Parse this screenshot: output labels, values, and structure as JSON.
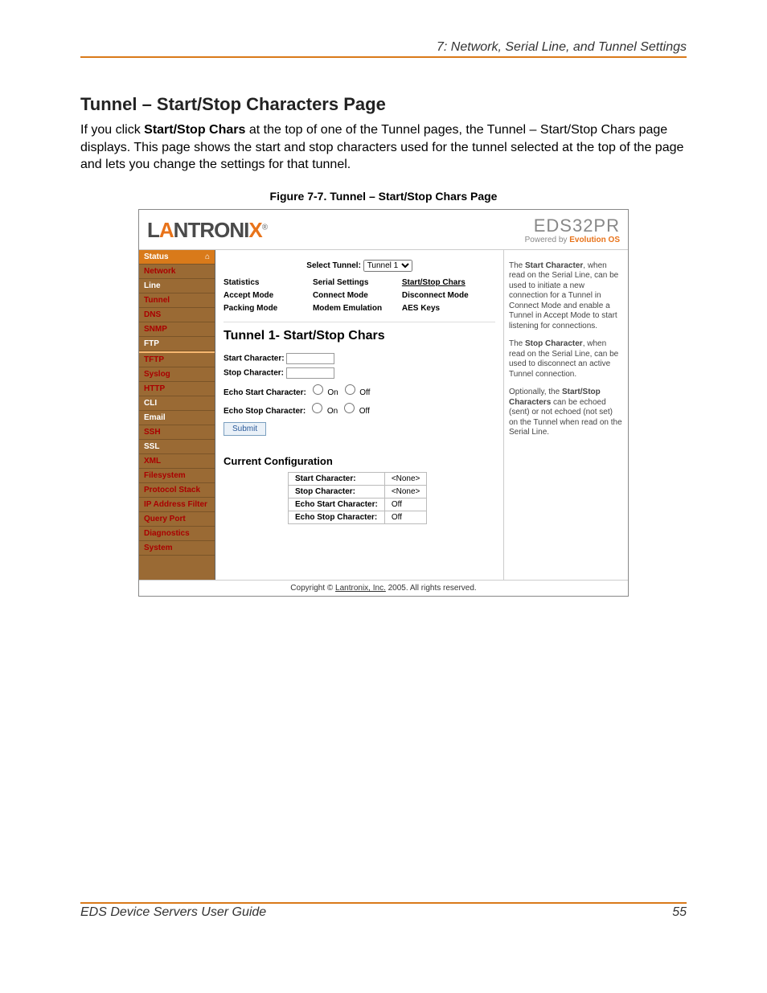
{
  "header_section": "7: Network, Serial Line, and Tunnel Settings",
  "heading": "Tunnel – Start/Stop Characters Page",
  "intro_p1": "If you click ",
  "intro_bold": "Start/Stop Chars",
  "intro_p2": " at the top of one of the Tunnel pages, the Tunnel – Start/Stop Chars page displays. This page shows the start and stop characters used for the tunnel selected at the top of the page and lets you change the settings for that tunnel.",
  "figure_caption": "Figure 7-7. Tunnel – Start/Stop Chars Page",
  "logo_left_a": "L",
  "logo_left_b": "A",
  "logo_left_c": "NTRONI",
  "logo_left_d": "X",
  "logo_left_reg": "®",
  "logo_right_model": "EDS32PR",
  "logo_right_powered": "Powered by ",
  "logo_right_evo": "Evolution OS",
  "sidebar": {
    "items": [
      "Status",
      "Network",
      "Line",
      "Tunnel",
      "DNS",
      "SNMP",
      "FTP",
      "TFTP",
      "Syslog",
      "HTTP",
      "CLI",
      "Email",
      "SSH",
      "SSL",
      "XML",
      "Filesystem",
      "Protocol Stack",
      "IP Address Filter",
      "Query Port",
      "Diagnostics",
      "System"
    ]
  },
  "select_tunnel_label": "Select Tunnel:",
  "select_tunnel_value": "Tunnel 1",
  "subnav": {
    "row1": [
      "Statistics",
      "Serial Settings",
      "Start/Stop Chars"
    ],
    "row2": [
      "Accept Mode",
      "Connect Mode",
      "Disconnect Mode"
    ],
    "row3": [
      "Packing Mode",
      "Modem Emulation",
      "AES Keys"
    ]
  },
  "inner_title": "Tunnel 1- Start/Stop Chars",
  "form": {
    "start_char_label": "Start Character:",
    "stop_char_label": "Stop Character:",
    "echo_start_label": "Echo Start Character:",
    "echo_stop_label": "Echo Stop Character:",
    "on": "On",
    "off": "Off",
    "submit": "Submit"
  },
  "current_heading": "Current Configuration",
  "conf": {
    "r1k": "Start Character:",
    "r1v": "<None>",
    "r2k": "Stop Character:",
    "r2v": "<None>",
    "r3k": "Echo Start Character:",
    "r3v": "Off",
    "r4k": "Echo Stop Character:",
    "r4v": "Off"
  },
  "copyright_a": "Copyright © ",
  "copyright_link": "Lantronix, Inc.",
  "copyright_b": " 2005. All rights reserved.",
  "help": {
    "p1a": "The ",
    "p1b": "Start Character",
    "p1c": ", when read on the Serial Line, can be used to initiate a new connection for a Tunnel in Connect Mode and enable a Tunnel in Accept Mode to start listening for connections.",
    "p2a": "The ",
    "p2b": "Stop Character",
    "p2c": ", when read on the Serial Line, can be used to disconnect an active Tunnel connection.",
    "p3a": "Optionally, the ",
    "p3b": "Start/Stop Characters",
    "p3c": " can be echoed (sent) or not echoed (not set) on the Tunnel when read on the Serial Line."
  },
  "footer_left": "EDS Device Servers User Guide",
  "footer_right": "55"
}
